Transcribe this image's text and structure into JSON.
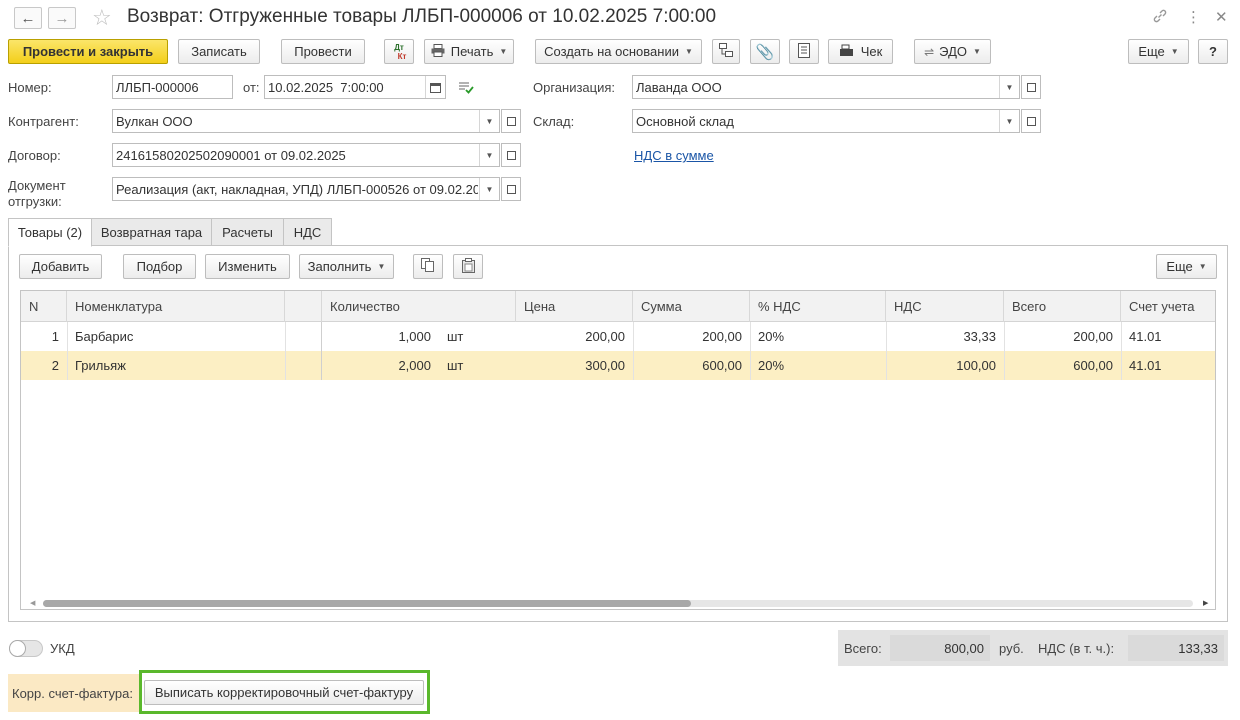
{
  "window": {
    "title": "Возврат: Отгруженные товары ЛЛБП-000006 от 10.02.2025 7:00:00",
    "icons": [
      "back-arrow-icon",
      "forward-arrow-icon",
      "star-icon",
      "link-icon",
      "more-vertical-icon",
      "close-icon"
    ]
  },
  "toolbar": {
    "post_close": "Провести и закрыть",
    "save": "Записать",
    "post": "Провести",
    "dtkt_top": "Дт",
    "dtkt_bottom": "Кт",
    "print": "Печать",
    "create_based": "Создать на основании",
    "receipt": "Чек",
    "edo": "ЭДО",
    "more": "Еще",
    "help": "?"
  },
  "form": {
    "number_label": "Номер:",
    "number_value": "ЛЛБП-000006",
    "date_label": "от:",
    "date_value": "10.02.2025  7:00:00",
    "org_label": "Организация:",
    "org_value": "Лаванда ООО",
    "counterparty_label": "Контрагент:",
    "counterparty_value": "Вулкан ООО",
    "warehouse_label": "Склад:",
    "warehouse_value": "Основной склад",
    "contract_label": "Договор:",
    "contract_value": "24161580202502090001 от 09.02.2025",
    "vat_link": "НДС в сумме",
    "shipment_label_1": "Документ",
    "shipment_label_2": "отгрузки:",
    "shipment_value": "Реализация (акт, накладная, УПД) ЛЛБП-000526 от 09.02.20"
  },
  "tabs": [
    "Товары (2)",
    "Возвратная тара",
    "Расчеты",
    "НДС"
  ],
  "table_toolbar": {
    "add": "Добавить",
    "pick": "Подбор",
    "edit": "Изменить",
    "fill": "Заполнить",
    "more": "Еще"
  },
  "table": {
    "headers": [
      "N",
      "Номенклатура",
      "Количество",
      "Цена",
      "Сумма",
      "% НДС",
      "НДС",
      "Всего",
      "Счет учета"
    ],
    "rows": [
      {
        "n": "1",
        "item": "Барбарис",
        "qty": "1,000",
        "unit": "шт",
        "price": "200,00",
        "sum": "200,00",
        "vat_rate": "20%",
        "vat": "33,33",
        "total": "200,00",
        "account": "41.01"
      },
      {
        "n": "2",
        "item": "Грильяж",
        "qty": "2,000",
        "unit": "шт",
        "price": "300,00",
        "sum": "600,00",
        "vat_rate": "20%",
        "vat": "100,00",
        "total": "600,00",
        "account": "41.01"
      }
    ]
  },
  "footer": {
    "ukd_label": "УКД",
    "ukd_on": false,
    "total_label": "Всего:",
    "total_value": "800,00",
    "currency": "руб.",
    "vat_label": "НДС (в т. ч.):",
    "vat_value": "133,33",
    "corr_label": "Корр. счет-фактура:",
    "corr_button": "Выписать корректировочный счет-фактуру"
  },
  "colors": {
    "primary_button": "#f5d22b",
    "selected_row": "#fcefc4",
    "link": "#1a55a6",
    "highlight_frame": "#5ab82c"
  }
}
